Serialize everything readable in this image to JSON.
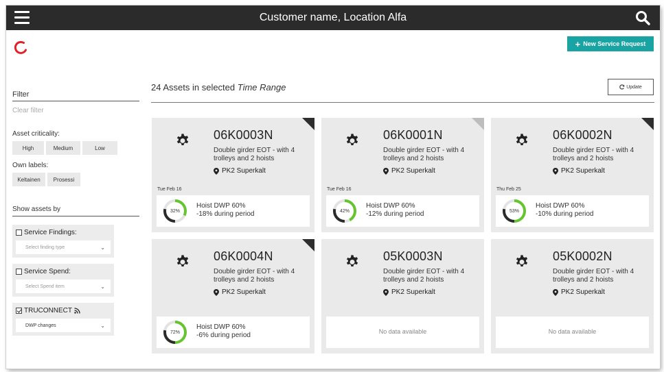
{
  "header": {
    "title": "Customer name, Location Alfa"
  },
  "actions": {
    "new_service_request": "New Service Request",
    "update": "Update"
  },
  "main": {
    "assets_count_prefix": "24 Assets in selected",
    "time_range_label": "Time Range"
  },
  "sidebar": {
    "filter_title": "Filter",
    "clear_filter": "Clear filter",
    "criticality_label": "Asset criticality:",
    "criticality_options": [
      "High",
      "Medium",
      "Low"
    ],
    "own_labels_label": "Own labels:",
    "own_labels": [
      "Keltainen",
      "Prosessi"
    ],
    "show_assets_label": "Show assets by",
    "service_findings": {
      "label": "Service Findings:",
      "checked": false,
      "placeholder": "Select finding type"
    },
    "service_spend": {
      "label": "Service Spend:",
      "checked": false,
      "placeholder": "Select Spend item"
    },
    "truconnect": {
      "label": "TRUCONNECT",
      "checked": true,
      "value": "DWP changes"
    }
  },
  "cards": [
    {
      "id": "06K0003N",
      "desc": "Double girder EOT - with 4 trolleys and 2 hoists",
      "location": "PK2 Superkalt",
      "date": "Tue Feb 16",
      "percent": 32,
      "percent_label": "32%",
      "metric": "Hoist DWP 60%",
      "change": "-18% during period",
      "corner": "dark"
    },
    {
      "id": "06K0001N",
      "desc": "Double girder EOT - with 4 trolleys and 2 hoists",
      "location": "PK2 Superkalt",
      "date": "Tue Feb 16",
      "percent": 42,
      "percent_label": "42%",
      "metric": "Hoist DWP 60%",
      "change": "-12% during period",
      "corner": "light"
    },
    {
      "id": "06K0002N",
      "desc": "Double girder EOT - with 4 trolleys and 2 hoists",
      "location": "PK2 Superkalt",
      "date": "Thu Feb 25",
      "percent": 53,
      "percent_label": "53%",
      "metric": "Hoist DWP 60%",
      "change": "-10% during period",
      "corner": "dark"
    },
    {
      "id": "06K0004N",
      "desc": "Double girder EOT - with 4 trolleys and 2 hoists",
      "location": "PK2 Superkalt",
      "date": "",
      "percent": 72,
      "percent_label": "72%",
      "metric": "Hoist DWP 60%",
      "change": "-6% during period",
      "corner": "dark"
    },
    {
      "id": "05K0003N",
      "desc": "Double girder EOT - with 4 trolleys and 2 hoists",
      "location": "PK2 Superkalt",
      "nodata": "No data available"
    },
    {
      "id": "05K0002N",
      "desc": "Double girder EOT - with 4 trolleys and 2 hoists",
      "location": "PK2 Superkalt",
      "nodata": "No data available"
    }
  ],
  "colors": {
    "topbar": "#2b2b2b",
    "accent": "#1aa3a3",
    "ring_fill": "#66c430",
    "ring_dark": "#2b2b2b",
    "logo": "#e3202a"
  },
  "icons": {
    "menu": "hamburger-icon",
    "search": "search-icon",
    "gear": "gear-icon",
    "pin": "location-pin-icon",
    "rss": "rss-icon"
  }
}
